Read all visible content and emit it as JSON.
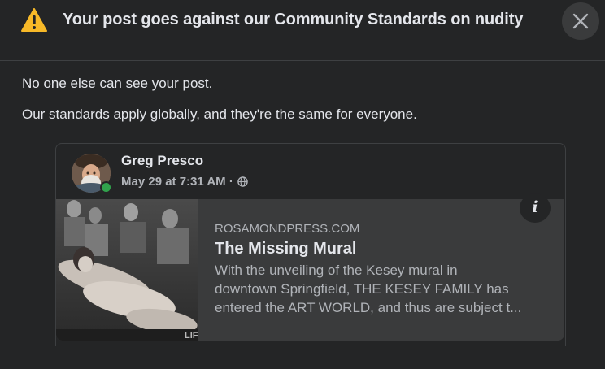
{
  "header": {
    "title": "Your post goes against our Community Standards on nudity",
    "warning_icon": "warning-triangle-icon",
    "warning_color": "#f7b928",
    "close_icon": "close-icon"
  },
  "messages": {
    "line1": "No one else can see your post.",
    "line2": "Our standards apply globally, and they're the same for everyone."
  },
  "post": {
    "author": "Greg Presco",
    "timestamp": "May 29 at 7:31 AM",
    "separator": "·",
    "audience_icon": "globe-icon",
    "online_status_color": "#31a24c"
  },
  "link_preview": {
    "domain": "ROSAMONDPRESS.COM",
    "title": "The Missing Mural",
    "description_lines": [
      "With the unveiling of the Kesey mural in",
      "downtown Springfield, THE KESEY FAMILY has",
      "entered the ART WORLD, and thus are subject t..."
    ],
    "info_label": "i",
    "thumb_caption": "LIF"
  }
}
